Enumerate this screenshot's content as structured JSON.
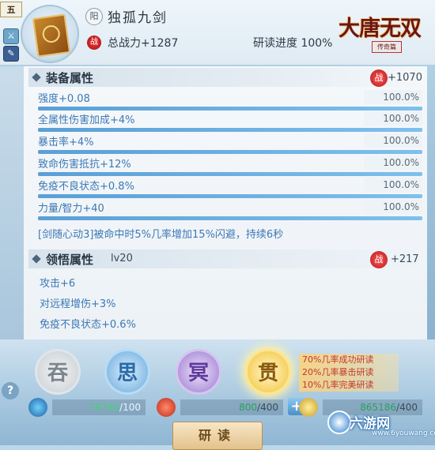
{
  "header": {
    "rank": "五",
    "yin_badge": "阳",
    "skill_name": "独孤九剑",
    "zhan_label": "战",
    "total_power": "总战力+1287",
    "progress": "研读进度 100%",
    "logo_title": "大唐无双",
    "logo_sub": "传奇篇"
  },
  "equipment": {
    "title": "装备属性",
    "zhan_label": "战",
    "power": "+1070",
    "attrs": [
      {
        "name": "强度+0.08",
        "pct": "100.0%",
        "fill": 1.0
      },
      {
        "name": "全属性伤害加成+4%",
        "pct": "100.0%",
        "fill": 1.0
      },
      {
        "name": "暴击率+4%",
        "pct": "100.0%",
        "fill": 1.0
      },
      {
        "name": "致命伤害抵抗+12%",
        "pct": "100.0%",
        "fill": 1.0
      },
      {
        "name": "免疫不良状态+0.8%",
        "pct": "100.0%",
        "fill": 1.0
      },
      {
        "name": "力量/智力+40",
        "pct": "100.0%",
        "fill": 1.0
      }
    ],
    "note": "[剑随心动3]被命中时5%几率增加15%闪避，持续6秒"
  },
  "comprehension": {
    "title": "领悟属性",
    "level": "lv20",
    "zhan_label": "战",
    "power": "+217",
    "attrs": [
      "攻击+6",
      "对远程增伤+3%",
      "免疫不良状态+0.6%"
    ]
  },
  "buttons": {
    "b1": "吞",
    "b2": "思",
    "b3": "冥",
    "b4": "贯"
  },
  "rates": [
    "70%几率成功研读",
    "20%几率暴击研读",
    "10%几率完美研读"
  ],
  "help": "?",
  "resources": {
    "r1": {
      "current": "76780",
      "max": "/100"
    },
    "r2": {
      "current": "800",
      "max": "/400",
      "plus": "+"
    },
    "r3": {
      "current": "865186",
      "max": "/400",
      "plus": "+"
    }
  },
  "study_button": "研读",
  "watermark": {
    "name": "六游网",
    "url": "www.6youwang.com"
  }
}
